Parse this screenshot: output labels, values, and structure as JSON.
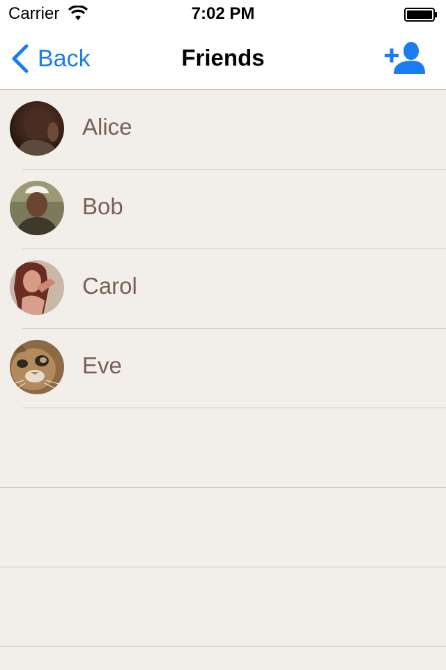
{
  "status_bar": {
    "carrier": "Carrier",
    "time": "7:02 PM",
    "icons": [
      "wifi-icon",
      "battery-icon"
    ]
  },
  "nav": {
    "back_label": "Back",
    "title": "Friends",
    "action_icon": "add-friend-icon",
    "tint_color": "#1a7cf0"
  },
  "friends": [
    {
      "name": "Alice",
      "avatar": "photo"
    },
    {
      "name": "Bob",
      "avatar": "photo"
    },
    {
      "name": "Carol",
      "avatar": "photo"
    },
    {
      "name": "Eve",
      "avatar": "cat-photo"
    }
  ],
  "colors": {
    "background": "#f2efea",
    "name_text": "#7a5f55",
    "separator": "#cfccc8"
  }
}
